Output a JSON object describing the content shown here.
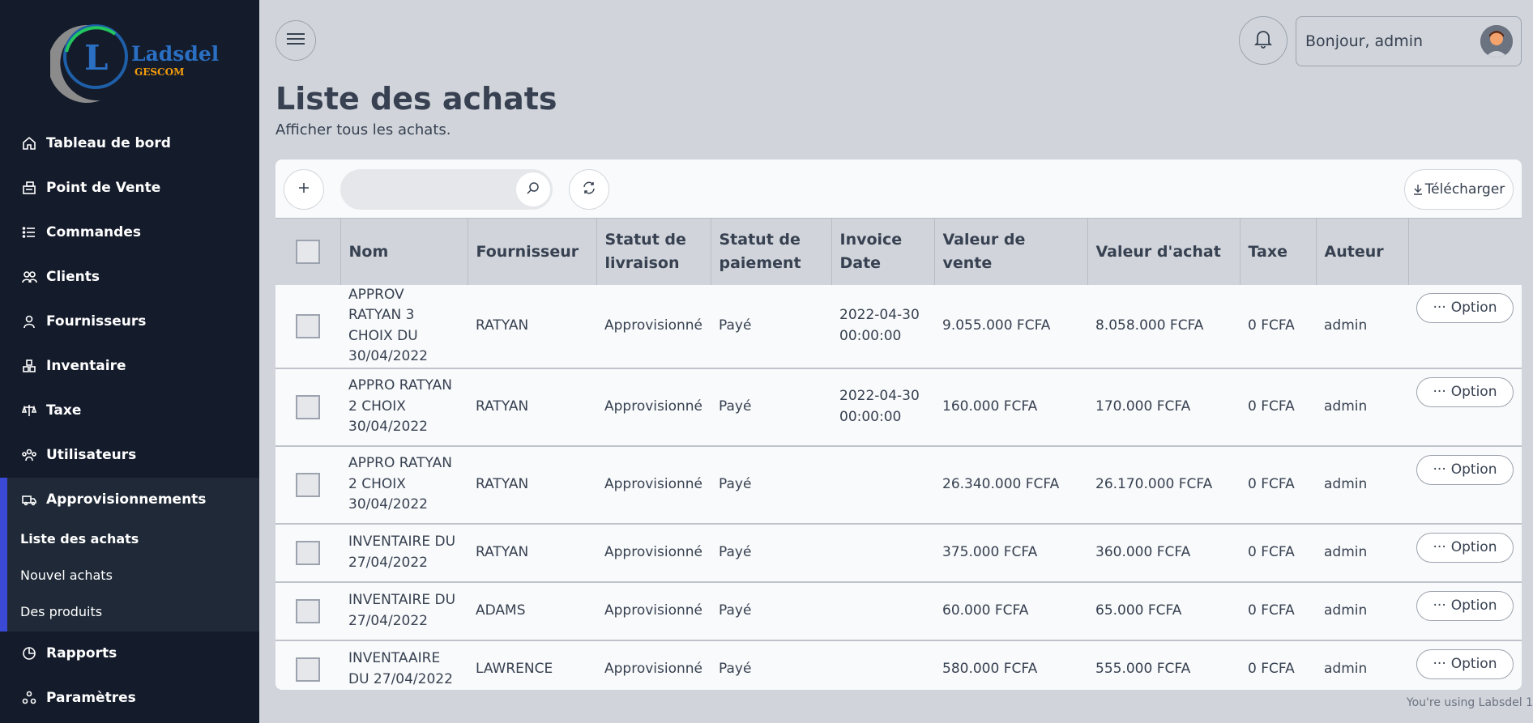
{
  "brand": {
    "name": "Ladsdel",
    "sub": "GESCOM",
    "letter": "L"
  },
  "sidebar": {
    "items": [
      {
        "label": "Tableau de bord",
        "icon": "home-icon"
      },
      {
        "label": "Point de Vente",
        "icon": "cash-register-icon"
      },
      {
        "label": "Commandes",
        "icon": "list-icon"
      },
      {
        "label": "Clients",
        "icon": "users-icon"
      },
      {
        "label": "Fournisseurs",
        "icon": "user-icon"
      },
      {
        "label": "Inventaire",
        "icon": "boxes-icon"
      },
      {
        "label": "Taxe",
        "icon": "scale-icon"
      },
      {
        "label": "Utilisateurs",
        "icon": "user-group-icon"
      },
      {
        "label": "Approvisionnements",
        "icon": "truck-icon"
      },
      {
        "label": "Rapports",
        "icon": "pie-chart-icon"
      },
      {
        "label": "Paramètres",
        "icon": "settings-icon"
      }
    ],
    "sub_items": [
      {
        "label": "Liste des achats",
        "active": true
      },
      {
        "label": "Nouvel achats",
        "active": false
      },
      {
        "label": "Des produits",
        "active": false
      }
    ]
  },
  "header": {
    "greeting": "Bonjour, admin"
  },
  "page": {
    "title": "Liste des achats",
    "subtitle": "Afficher tous les achats."
  },
  "toolbar": {
    "search_placeholder": "",
    "download_label": "Télécharger"
  },
  "table": {
    "columns": [
      "Nom",
      "Fournisseur",
      "Statut de livraison",
      "Statut de paiement",
      "Invoice Date",
      "Valeur de vente",
      "Valeur d'achat",
      "Taxe",
      "Auteur"
    ],
    "option_label": "Option",
    "rows": [
      {
        "nom": "APPROV RATYAN 3 CHOIX DU 30/04/2022",
        "fournisseur": "RATYAN",
        "livraison": "Approvisionné",
        "paiement": "Payé",
        "date": "2022-04-30 00:00:00",
        "vente": "9.055.000 FCFA",
        "achat": "8.058.000 FCFA",
        "taxe": "0 FCFA",
        "auteur": "admin"
      },
      {
        "nom": "APPRO RATYAN 2 CHOIX 30/04/2022",
        "fournisseur": "RATYAN",
        "livraison": "Approvisionné",
        "paiement": "Payé",
        "date": "2022-04-30 00:00:00",
        "vente": "160.000 FCFA",
        "achat": "170.000 FCFA",
        "taxe": "0 FCFA",
        "auteur": "admin"
      },
      {
        "nom": "APPRO RATYAN 2 CHOIX 30/04/2022",
        "fournisseur": "RATYAN",
        "livraison": "Approvisionné",
        "paiement": "Payé",
        "date": "",
        "vente": "26.340.000 FCFA",
        "achat": "26.170.000 FCFA",
        "taxe": "0 FCFA",
        "auteur": "admin"
      },
      {
        "nom": "INVENTAIRE DU 27/04/2022",
        "fournisseur": "RATYAN",
        "livraison": "Approvisionné",
        "paiement": "Payé",
        "date": "",
        "vente": "375.000 FCFA",
        "achat": "360.000 FCFA",
        "taxe": "0 FCFA",
        "auteur": "admin"
      },
      {
        "nom": "INVENTAIRE DU 27/04/2022",
        "fournisseur": "ADAMS",
        "livraison": "Approvisionné",
        "paiement": "Payé",
        "date": "",
        "vente": "60.000 FCFA",
        "achat": "65.000 FCFA",
        "taxe": "0 FCFA",
        "auteur": "admin"
      },
      {
        "nom": "INVENTAAIRE DU 27/04/2022",
        "fournisseur": "LAWRENCE",
        "livraison": "Approvisionné",
        "paiement": "Payé",
        "date": "",
        "vente": "580.000 FCFA",
        "achat": "555.000 FCFA",
        "taxe": "0 FCFA",
        "auteur": "admin"
      }
    ]
  },
  "footer": {
    "text": "You're using Labsdel 1"
  }
}
